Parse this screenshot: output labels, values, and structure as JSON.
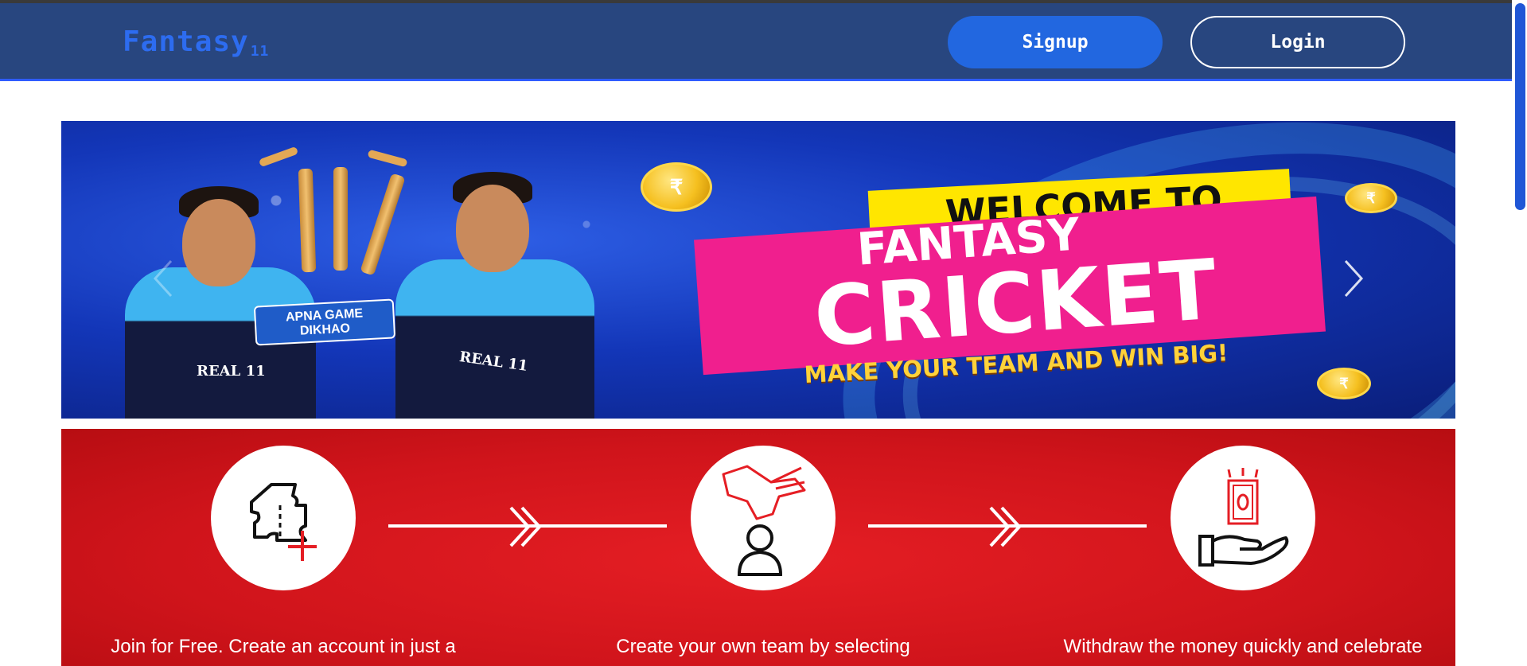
{
  "navbar": {
    "brand_name": "Fantasy",
    "brand_suffix": "11",
    "signup_label": "Signup",
    "login_label": "Login"
  },
  "banner": {
    "welcome": "WELCOME TO",
    "fantasy": "FANTASY",
    "cricket": "CRICKET",
    "tagline": "MAKE YOUR TEAM AND WIN BIG!",
    "card_tag_line1": "APNA GAME",
    "card_tag_line2": "DIKHAO",
    "jersey_left": "REAL 11",
    "jersey_right": "REAL 11",
    "coin_symbol": "₹"
  },
  "steps": [
    {
      "icon": "ticket-plus-icon",
      "text": "Join for Free. Create an account in just a"
    },
    {
      "icon": "hand-select-player-icon",
      "text": "Create your own team by selecting"
    },
    {
      "icon": "hand-money-icon",
      "text": "Withdraw the money quickly and celebrate"
    }
  ],
  "colors": {
    "navbar_bg": "#28467f",
    "accent_blue": "#2267e0",
    "steps_red": "#d0141b",
    "banner_pink": "#f01f8e",
    "banner_yellow": "#ffe600"
  }
}
